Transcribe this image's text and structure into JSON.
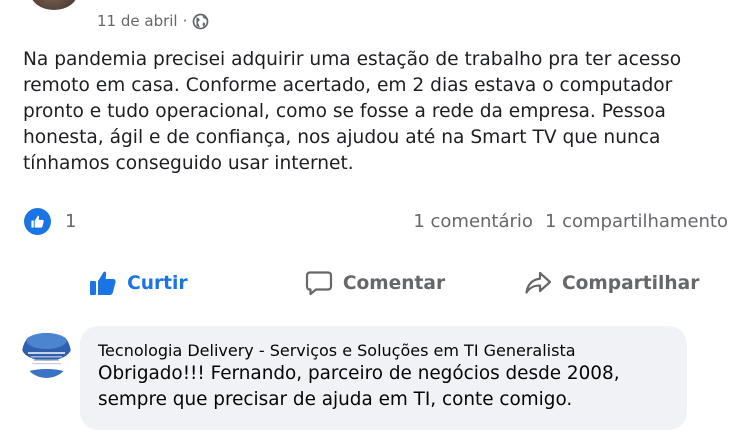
{
  "post": {
    "date": "11 de abril",
    "separator": "·",
    "privacy_icon": "globe-icon",
    "text_lines": [
      "Na pandemia precisei adquirir uma estação de trabalho pra ter acesso",
      "remoto em casa. Conforme acertado, em 2 dias estava o computador",
      "pronto e tudo operacional, como se fosse a rede da empresa. Pessoa",
      "honesta, ágil e de confiança, nos ajudou até na Smart TV que nunca",
      "tínhamos conseguido usar internet."
    ]
  },
  "reactions": {
    "icon": "like-icon",
    "count": "1",
    "comments": "1 comentário",
    "shares": "1 compartilhamento"
  },
  "actions": {
    "like_label": "Curtir",
    "comment_label": "Comentar",
    "share_label": "Compartilhar"
  },
  "comment": {
    "author": "Tecnologia Delivery - Serviços e Soluções em TI Generalista",
    "text_lines": [
      "Obrigado!!! Fernando, parceiro de negócios desde 2008,",
      "sempre que precisar de ajuda em TI, conte comigo."
    ]
  },
  "colors": {
    "accent": "#1b74e4",
    "muted_text": "#65676b",
    "bubble": "#f0f2f5"
  }
}
